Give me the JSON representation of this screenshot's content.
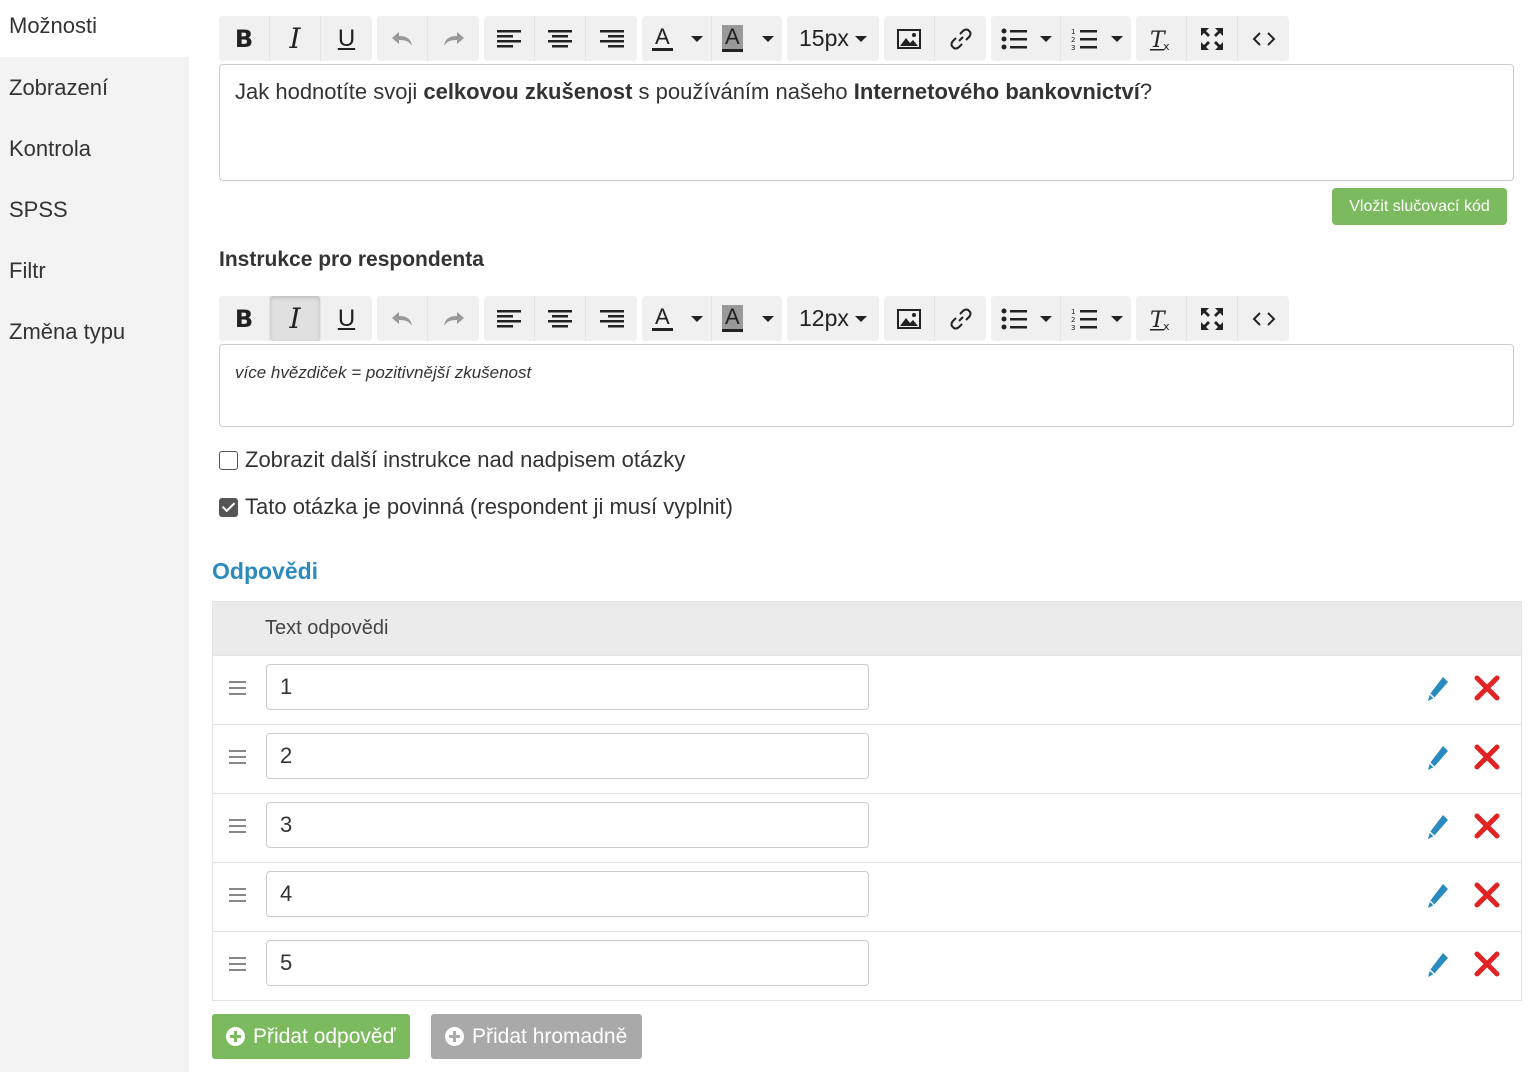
{
  "sidebar": {
    "items": [
      {
        "label": "Možnosti"
      },
      {
        "label": "Zobrazení"
      },
      {
        "label": "Kontrola"
      },
      {
        "label": "SPSS"
      },
      {
        "label": "Filtr"
      },
      {
        "label": "Změna typu"
      }
    ]
  },
  "toolbar": {
    "bold": "B",
    "italic": "I",
    "underline": "U",
    "font_color_letter": "A",
    "bg_color_letter": "A",
    "size_question": "15px",
    "size_instruction": "12px"
  },
  "question": {
    "text_parts": [
      "Jak hodnotíte svoji ",
      "celkovou zkušenost",
      " s používáním našeho ",
      "Internetového bankovnictví",
      "?"
    ]
  },
  "merge_button": "Vložit slučovací kód",
  "instructions": {
    "label": "Instrukce pro respondenta",
    "text": "více hvězdiček = pozitivnější zkušenost"
  },
  "checkboxes": [
    {
      "label": "Zobrazit další instrukce nad nadpisem otázky",
      "checked": false
    },
    {
      "label": "Tato otázka je povinná (respondent ji musí vyplnit)",
      "checked": true
    }
  ],
  "answers": {
    "title": "Odpovědi",
    "column_header": "Text odpovědi",
    "rows": [
      {
        "value": "1"
      },
      {
        "value": "2"
      },
      {
        "value": "3"
      },
      {
        "value": "4"
      },
      {
        "value": "5"
      }
    ]
  },
  "buttons": {
    "add_answer": "Přidat odpověď",
    "add_bulk": "Přidat hromadně"
  },
  "colors": {
    "accent_green": "#7cba5f",
    "link_blue": "#2a8bbf",
    "delete_red": "#e02424",
    "edit_blue": "#2a8bbf"
  }
}
